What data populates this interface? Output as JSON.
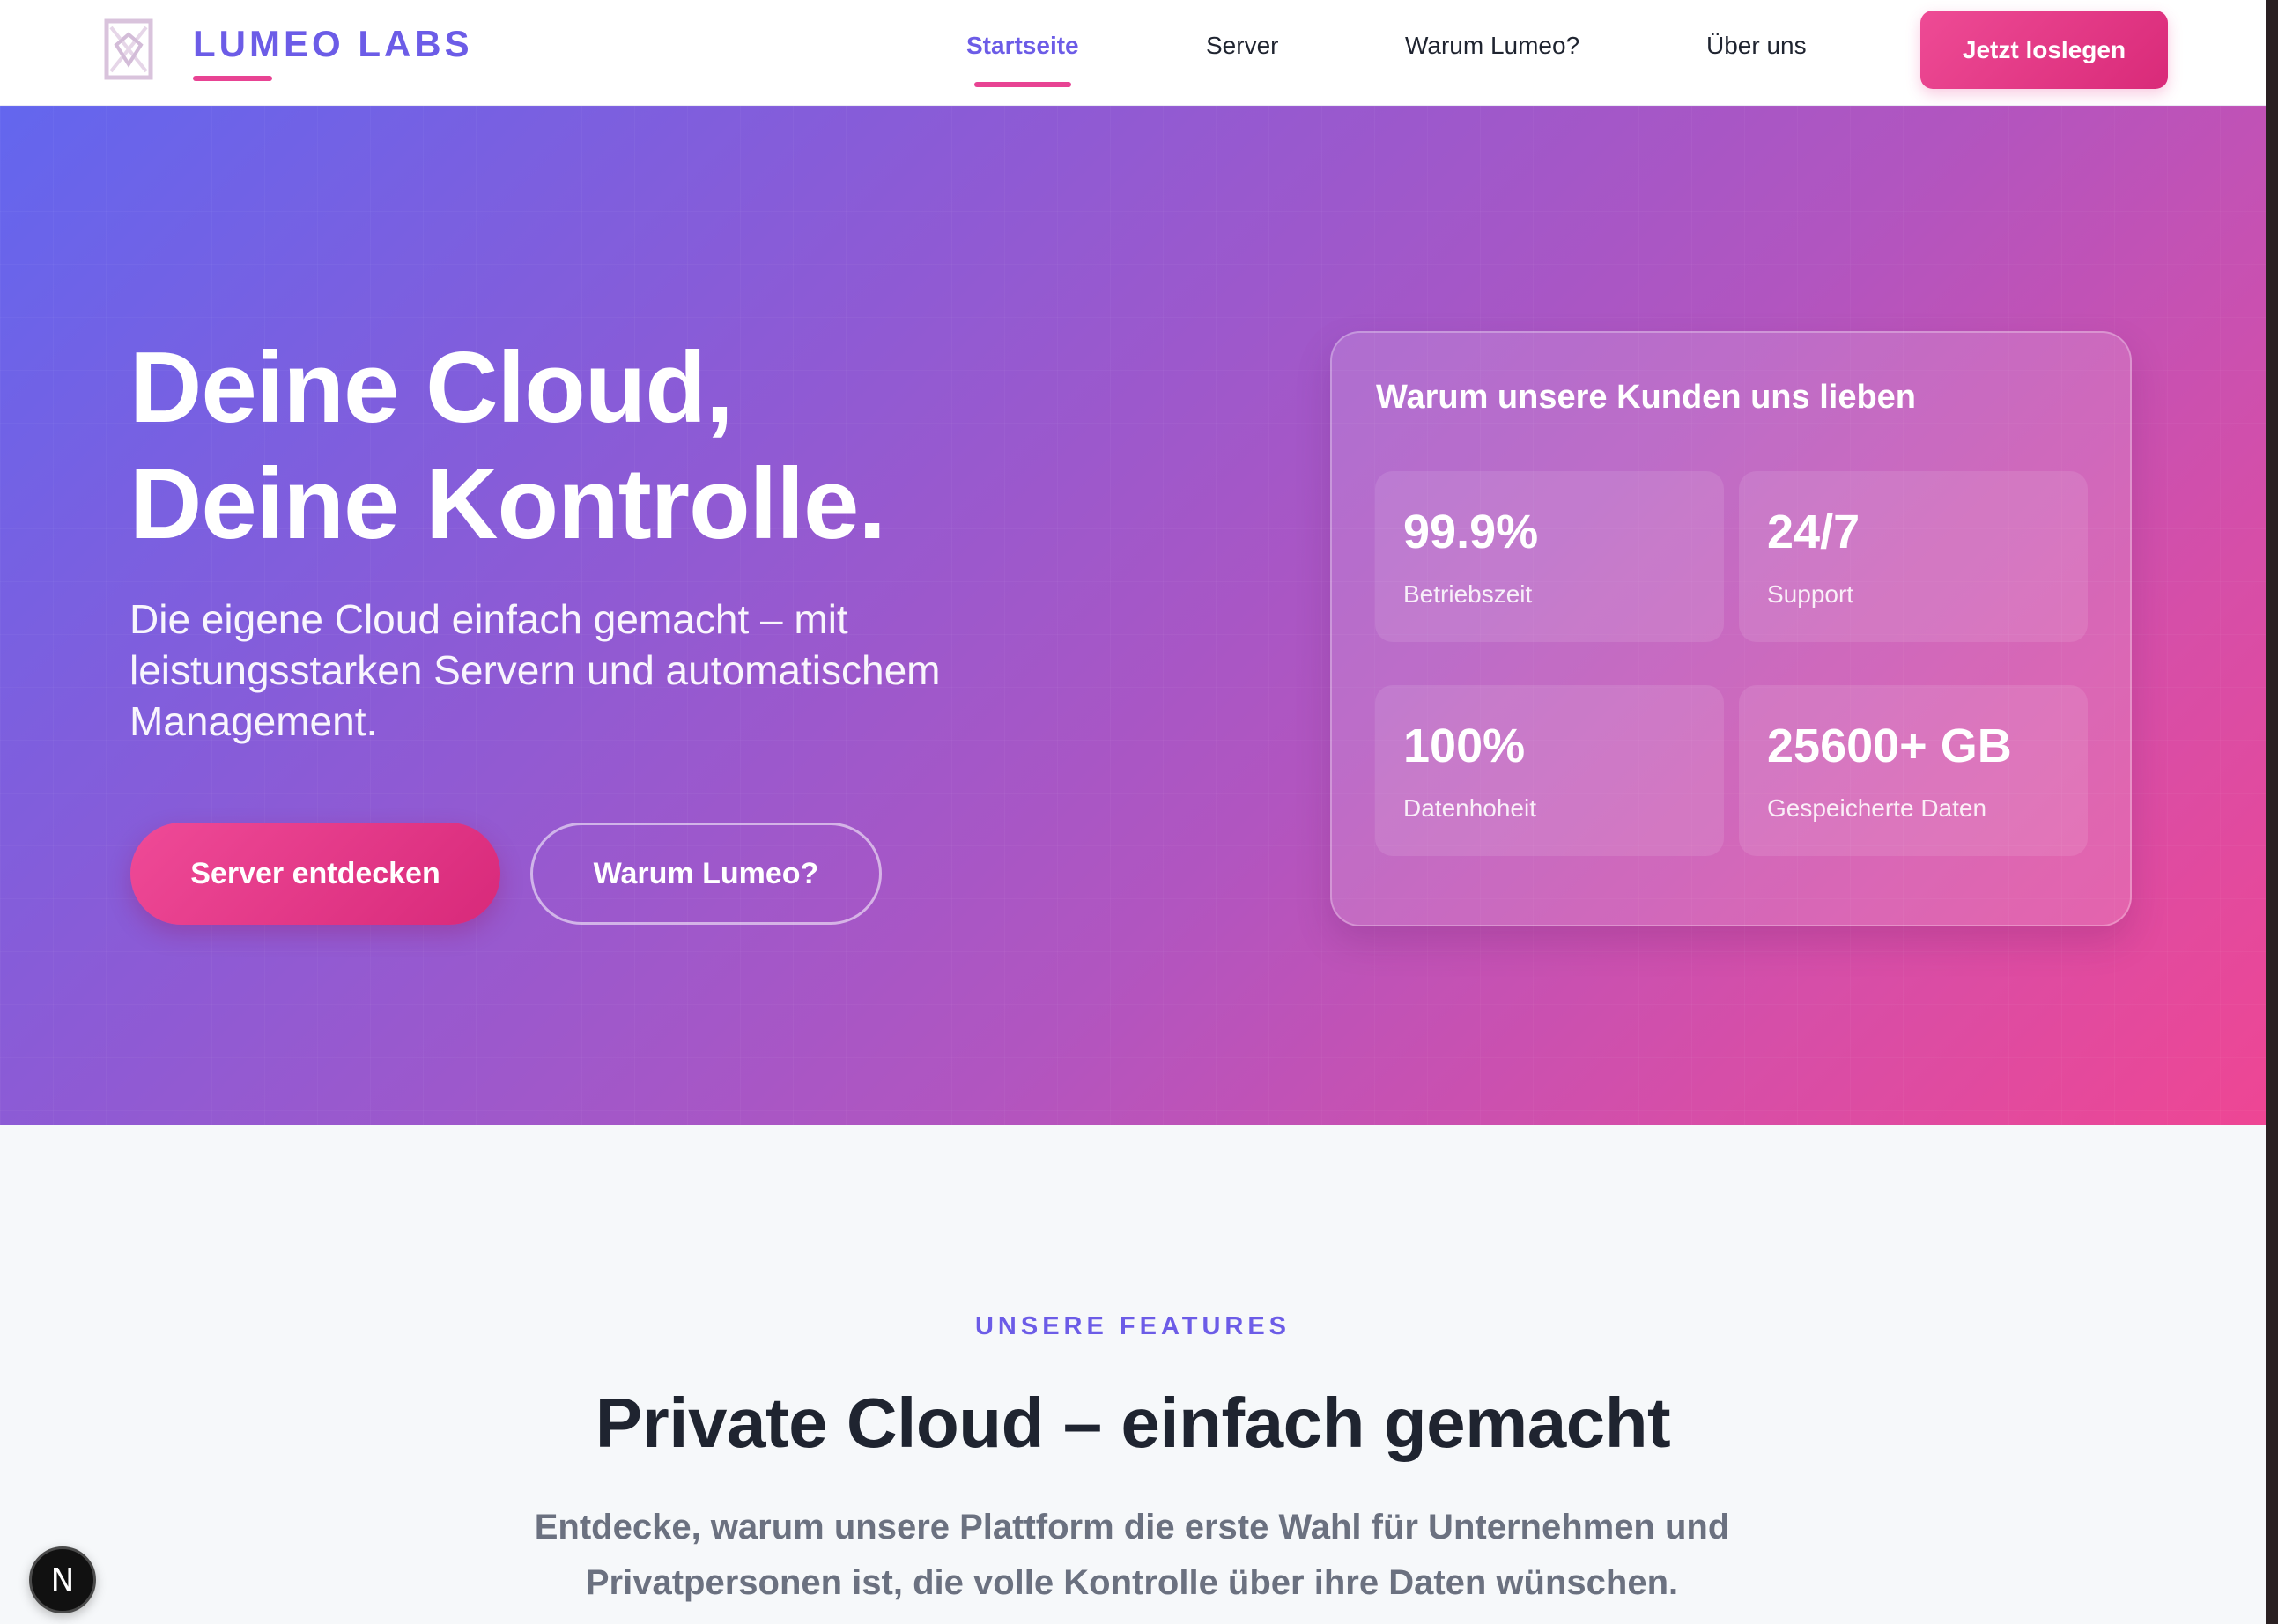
{
  "nav": {
    "brand": "LUMEO LABS",
    "links": [
      {
        "label": "Startseite",
        "active": true
      },
      {
        "label": "Server",
        "active": false
      },
      {
        "label": "Warum Lumeo?",
        "active": false
      },
      {
        "label": "Über uns",
        "active": false
      }
    ],
    "cta": "Jetzt loslegen"
  },
  "hero": {
    "title_line1": "Deine Cloud,",
    "title_line2": "Deine Kontrolle.",
    "subtitle": "Die eigene Cloud einfach gemacht – mit leistungsstarken Servern und automatischem Management.",
    "primary_button": "Server entdecken",
    "secondary_button": "Warum Lumeo?"
  },
  "stats": {
    "title": "Warum unsere Kunden uns lieben",
    "items": [
      {
        "value": "99.9%",
        "label": "Betriebszeit"
      },
      {
        "value": "24/7",
        "label": "Support"
      },
      {
        "value": "100%",
        "label": "Datenhoheit"
      },
      {
        "value": "25600+ GB",
        "label": "Gespeicherte Daten"
      }
    ]
  },
  "features": {
    "eyebrow": "UNSERE FEATURES",
    "title": "Private Cloud – einfach gemacht",
    "subtitle": "Entdecke, warum unsere Plattform die erste Wahl für Unternehmen und Privatpersonen ist, die volle Kontrolle über ihre Daten wünschen."
  },
  "dev_badge": {
    "letter": "N",
    "icon": "nextjs-dev-indicator-icon"
  },
  "colors": {
    "accent_purple": "#6c5ce7",
    "accent_pink": "#e84393",
    "hero_gradient_start": "#6366ee",
    "hero_gradient_end": "#ee4694"
  }
}
